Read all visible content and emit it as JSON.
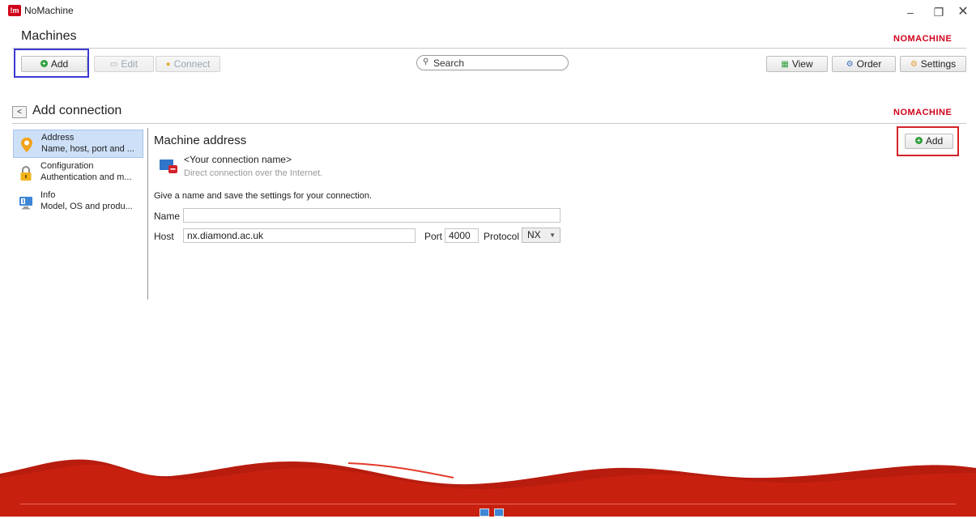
{
  "window": {
    "title": "NoMachine",
    "logo_text": "!m",
    "minimize": "–",
    "maximize": "❐",
    "close": "✕"
  },
  "header": {
    "section_title": "Machines",
    "brand": "NOMACHINE"
  },
  "toolbar": {
    "add_label": "Add",
    "edit_label": "Edit",
    "connect_label": "Connect",
    "search_placeholder": "Search",
    "view_label": "View",
    "order_label": "Order",
    "settings_label": "Settings"
  },
  "subheader": {
    "back_label": "<",
    "title": "Add connection",
    "brand": "NOMACHINE"
  },
  "nav": {
    "items": [
      {
        "title": "Address",
        "subtitle": "Name, host, port and ...",
        "icon": "location-pin-icon",
        "selected": true
      },
      {
        "title": "Configuration",
        "subtitle": "Authentication and m...",
        "icon": "lock-icon",
        "selected": false
      },
      {
        "title": "Info",
        "subtitle": "Model, OS and produ...",
        "icon": "info-computer-icon",
        "selected": false
      }
    ]
  },
  "panel": {
    "title": "Machine address",
    "connection_name": "<Your connection name>",
    "connection_sub": "Direct connection over the Internet.",
    "hint": "Give a name and save the settings for your connection.",
    "name_label": "Name",
    "name_value": "",
    "host_label": "Host",
    "host_value": "nx.diamond.ac.uk",
    "port_label": "Port",
    "port_value": "4000",
    "protocol_label": "Protocol",
    "protocol_value": "NX",
    "add_label": "Add"
  },
  "colors": {
    "brand_red": "#d0021b",
    "highlight_blue": "#3b3bd1",
    "highlight_red": "#d3232a",
    "selected_bg": "#cde0f7"
  }
}
